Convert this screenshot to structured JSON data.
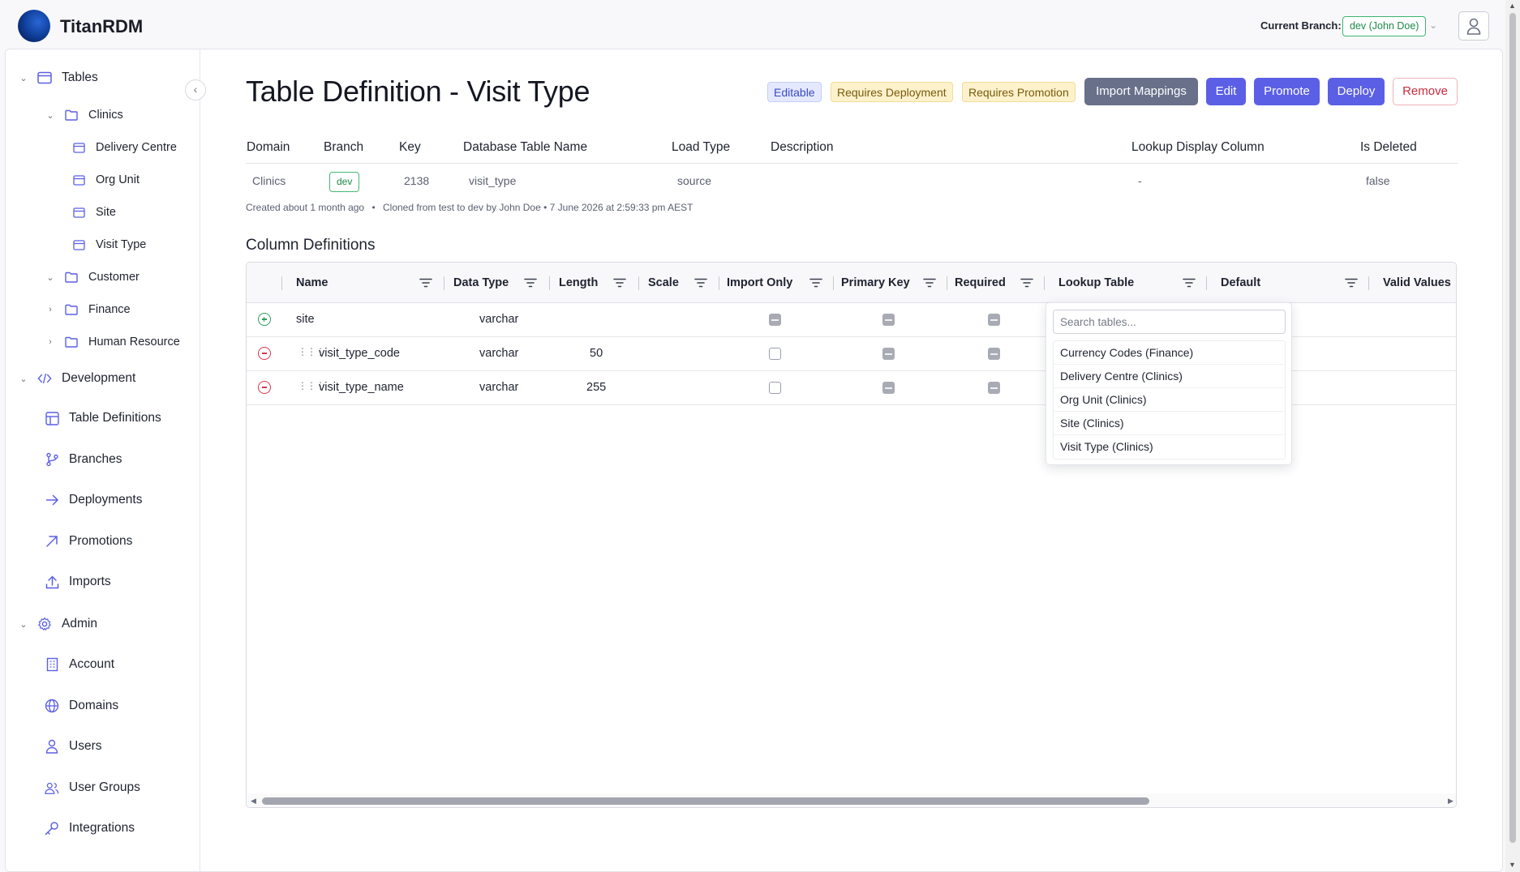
{
  "app": {
    "title": "TitanRDM"
  },
  "header": {
    "branch_label": "Current Branch:",
    "branch_value": "dev (John Doe)"
  },
  "sidebar": {
    "tables_label": "Tables",
    "clinics_label": "Clinics",
    "clinics_items": [
      "Delivery Centre",
      "Org Unit",
      "Site",
      "Visit Type"
    ],
    "customer_label": "Customer",
    "finance_label": "Finance",
    "human_resource_label": "Human Resource",
    "development_label": "Development",
    "development_items": [
      "Table Definitions",
      "Branches",
      "Deployments",
      "Promotions",
      "Imports"
    ],
    "admin_label": "Admin",
    "admin_items": [
      "Account",
      "Domains",
      "Users",
      "User Groups",
      "Integrations"
    ]
  },
  "page": {
    "title": "Table Definition - Visit Type",
    "badges": {
      "editable": "Editable",
      "requires_deployment": "Requires Deployment",
      "requires_promotion": "Requires Promotion"
    },
    "actions": {
      "import": "Import Mappings",
      "edit": "Edit",
      "promote": "Promote",
      "deploy": "Deploy",
      "remove": "Remove"
    },
    "meta_headers": [
      "Domain",
      "Branch",
      "Key",
      "Database Table Name",
      "Load Type",
      "Description",
      "Lookup Display Column",
      "Is Deleted"
    ],
    "meta_values": {
      "domain": "Clinics",
      "branch": "dev",
      "key": "2138",
      "db_table": "visit_type",
      "load_type": "source",
      "description": "",
      "lookup_display": "-",
      "is_deleted": "false"
    },
    "created": "Created about 1 month ago",
    "bullet": "•",
    "cloned": "Cloned from test to dev by John Doe • 7 June 2026 at 2:59:33 pm AEST",
    "section_title": "Column Definitions"
  },
  "grid": {
    "columns": [
      "Name",
      "Data Type",
      "Length",
      "Scale",
      "Import Only",
      "Primary Key",
      "Required",
      "Lookup Table",
      "Default",
      "Valid Values"
    ],
    "rows": [
      {
        "name": "site",
        "data_type": "varchar",
        "length": ""
      },
      {
        "name": "visit_type_code",
        "data_type": "varchar",
        "length": "50"
      },
      {
        "name": "visit_type_name",
        "data_type": "varchar",
        "length": "255"
      }
    ]
  },
  "dropdown": {
    "search_placeholder": "Search tables...",
    "options": [
      "Currency Codes (Finance)",
      "Delivery Centre (Clinics)",
      "Org Unit (Clinics)",
      "Site (Clinics)",
      "Visit Type (Clinics)"
    ]
  },
  "colors": {
    "primary": "#5b5fe6",
    "secondary": "#68708a",
    "danger": "#c92a3d",
    "success": "#1d8a48",
    "warning_bg": "#fdf2cc"
  }
}
